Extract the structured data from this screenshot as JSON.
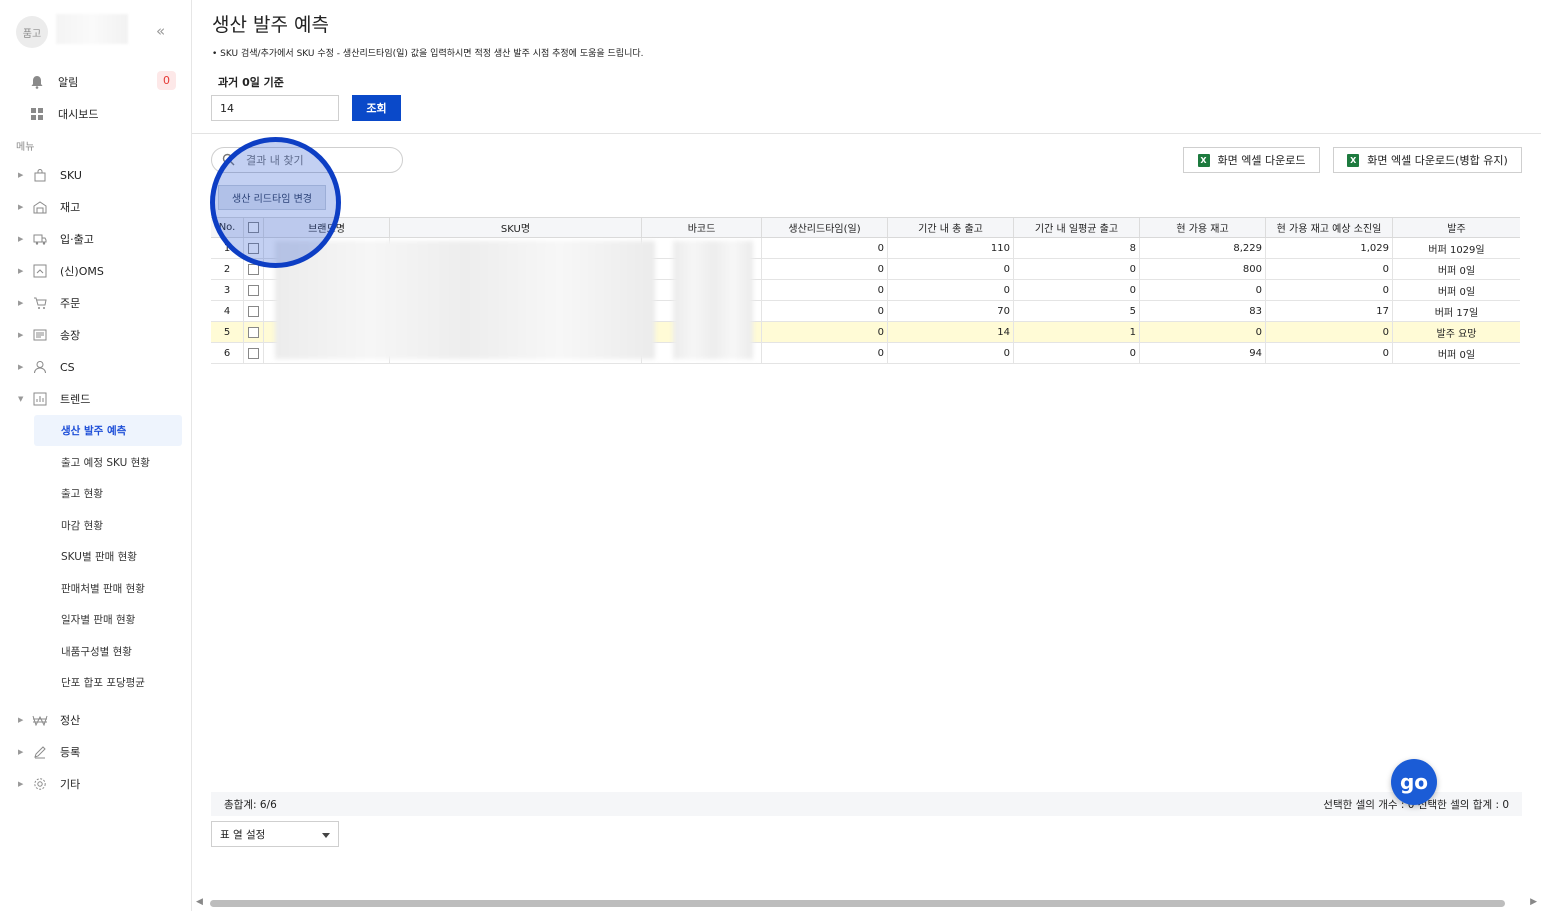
{
  "sidebar": {
    "avatar_text": "품고",
    "collapse_icon": "«",
    "top_items": [
      {
        "label": "알림",
        "icon": "bell-icon",
        "badge": "0"
      },
      {
        "label": "대시보드",
        "icon": "dashboard-icon"
      }
    ],
    "menu_label": "메뉴",
    "items": [
      {
        "label": "SKU",
        "icon": "bag-icon"
      },
      {
        "label": "재고",
        "icon": "warehouse-icon"
      },
      {
        "label": "입·출고",
        "icon": "truck-icon"
      },
      {
        "label": "(신)OMS",
        "icon": "oms-icon"
      },
      {
        "label": "주문",
        "icon": "cart-icon"
      },
      {
        "label": "송장",
        "icon": "invoice-icon"
      },
      {
        "label": "CS",
        "icon": "person-icon"
      },
      {
        "label": "트렌드",
        "icon": "chart-icon"
      }
    ],
    "sub_items": [
      "생산 발주 예측",
      "출고 예정 SKU 현황",
      "출고 현황",
      "마감 현황",
      "SKU별 판매 현황",
      "판매처별 판매 현황",
      "일자별 판매 현황",
      "내품구성별 현황",
      "단포 합포 포당평균"
    ],
    "bottom_items": [
      {
        "label": "정산",
        "icon": "won-icon"
      },
      {
        "label": "등록",
        "icon": "pencil-icon"
      },
      {
        "label": "기타",
        "icon": "gear-icon"
      }
    ]
  },
  "page": {
    "title": "생산 발주 예측",
    "description": "• SKU 검색/추가에서 SKU 수정 - 생산리드타임(일) 값을 입력하시면 적정 생산 발주 시점 추정에 도움을 드립니다.",
    "days_label": "과거 0일 기준",
    "days_value": "14",
    "query_button": "조회",
    "search_placeholder": "결과 내 찾기",
    "excel_button": "화면 엑셀 다운로드",
    "excel_merge_button": "화면 엑셀 다운로드(병합 유지)",
    "lead_time_button": "생산 리드타임 변경"
  },
  "table": {
    "headers": [
      "No.",
      "",
      "브랜드명",
      "SKU명",
      "바코드",
      "생산리드타임(일)",
      "기간 내 총 출고",
      "기간 내 일평균 출고",
      "현 가용 재고",
      "현 가용 재고 예상 소진일",
      "발주"
    ],
    "rows": [
      {
        "no": "1",
        "lead": "0",
        "total": "110",
        "avg": "8",
        "stock": "8,229",
        "days": "1,029",
        "order": "버퍼 1029일"
      },
      {
        "no": "2",
        "lead": "0",
        "total": "0",
        "avg": "0",
        "stock": "800",
        "days": "0",
        "order": "버퍼 0일"
      },
      {
        "no": "3",
        "lead": "0",
        "total": "0",
        "avg": "0",
        "stock": "0",
        "days": "0",
        "order": "버퍼 0일"
      },
      {
        "no": "4",
        "lead": "0",
        "total": "70",
        "avg": "5",
        "stock": "83",
        "days": "17",
        "order": "버퍼 17일"
      },
      {
        "no": "5",
        "lead": "0",
        "total": "14",
        "avg": "1",
        "stock": "0",
        "days": "0",
        "order": "발주 요망"
      },
      {
        "no": "6",
        "lead": "0",
        "total": "0",
        "avg": "0",
        "stock": "94",
        "days": "0",
        "order": "버퍼 0일"
      }
    ]
  },
  "footer": {
    "total": "총합계: 6/6",
    "selection": "선택한 셀의 개수 : 0 선택한 셀의 합계 : 0",
    "column_settings": "표 열 설정"
  },
  "help_button": "go",
  "colors": {
    "accent": "#0a49c9",
    "highlight_row": "#fffbd6",
    "badge": "#e53935"
  }
}
